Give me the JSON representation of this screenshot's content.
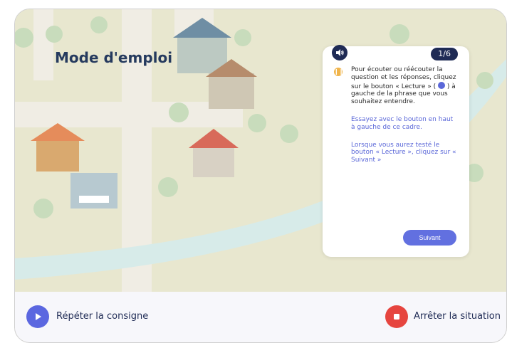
{
  "header": {
    "title": "Mode d'emploi"
  },
  "instruction_card": {
    "page_indicator": "1/6",
    "paragraph_1_part1": "Pour écouter ou réécouter la question et les réponses, cliquez sur le bouton « Lecture » (",
    "paragraph_1_part2": ") à gauche de la phrase que vous souhaitez entendre.",
    "paragraph_2": "Essayez avec le bouton en haut à gauche de ce cadre.",
    "paragraph_3": "Lorsque vous aurez testé le bouton « Lecture », cliquez sur « Suivant »",
    "next_button": "Suivant"
  },
  "footer": {
    "repeat_label": "Répéter la consigne",
    "stop_label": "Arrêter la situation"
  },
  "colors": {
    "dark_navy": "#1f2b55",
    "accent_blue": "#5b67e0",
    "stop_red": "#e6453f",
    "info_orange": "#f0b44b"
  },
  "icons": {
    "audio": "speaker-icon",
    "info": "info-icon",
    "repeat": "play-icon",
    "stop": "stop-icon"
  }
}
